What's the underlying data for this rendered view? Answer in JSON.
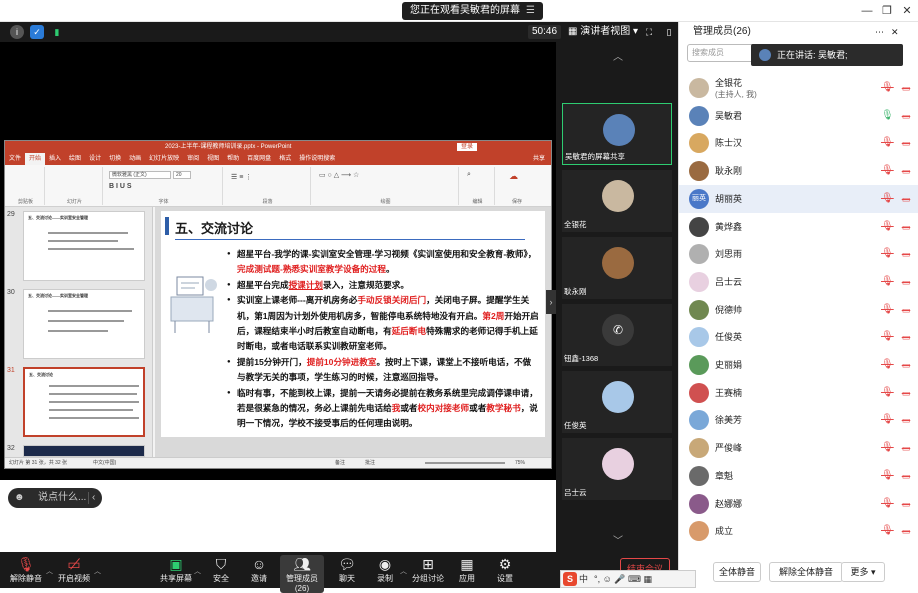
{
  "window": {
    "viewing_banner": "您正在观看吴敏君的屏幕",
    "minimize": "—",
    "restore": "❐",
    "close": "✕"
  },
  "topbar": {
    "timer": "50:46",
    "view_mode": "演讲者视图"
  },
  "ppt": {
    "title": "2023-上半年-课程教师培训录.pptx - PowerPoint",
    "login": "登录",
    "share": "共享",
    "tabs": [
      "文件",
      "开始",
      "插入",
      "绘图",
      "设计",
      "切换",
      "动画",
      "幻灯片放映",
      "审阅",
      "视图",
      "帮助",
      "百度网盘",
      "格式",
      "操作说明搜索"
    ],
    "active_tab": "开始",
    "ribbon_groups": [
      "剪贴板",
      "幻灯片",
      "字体",
      "段落",
      "绘图",
      "编辑",
      "保存"
    ],
    "font_name": "微软雅黑 (正文)",
    "font_size": "20",
    "thumb_nums": [
      "29",
      "30",
      "31",
      "32"
    ],
    "thumb_titles": [
      "五、交流讨论——实训室安全管理",
      "五、交流讨论——实训室安全管理",
      "五、交流讨论",
      ""
    ],
    "status_left": "幻灯片 第 31 张，共 32 张",
    "status_lang": "中文(中国)",
    "status_notes": "备注",
    "status_comments": "批注",
    "status_zoom": "75%"
  },
  "slide": {
    "title": "五、交流讨论",
    "b1_a": "超星平台-我学的课-实训室安全管理-学习视频《实训室使用和安全教育-教师》，",
    "b1_b": "完成测试题-熟悉实训室教学设备的过程",
    "b1_c": "。",
    "b2_a": "超星平台完成",
    "b2_b": "授课计划",
    "b2_c": "录入，注意规范要求。",
    "b3_a": "实训室上课老师---离开机房务必",
    "b3_b": "手动反锁关闭后门",
    "b3_c": "，关闭电子屏。提醒学生关机，第1周因为计划外使用机房多，智能停电系统特地没有开启。",
    "b3_d": "第2周",
    "b3_e": "开始开启后，课程结束半小时后教室自动断电，有",
    "b3_f": "延后断电",
    "b3_g": "特殊需求的老师记得手机上延时断电，或者电话联系实训教研室老师。",
    "b4_a": "提前15分钟开门，",
    "b4_b": "提前10分钟进教室",
    "b4_c": "。按时上下课，课堂上不接听电话，不做与教学无关的事项，学生练习的时候，注意巡回指导。",
    "b5_a": "临时有事，不能到校上课，提前一天请务必提前在教务系统里完成调停课申请，若是很紧急的情况，务必上课前先电话给",
    "b5_b": "我",
    "b5_c": "或者",
    "b5_d": "校内对接老师",
    "b5_e": "或者",
    "b5_f": "教学秘书",
    "b5_g": "，说明一下情况，学校不接受事后的任何理由说明。"
  },
  "chat": {
    "placeholder": "说点什么...",
    "collapse": "‹"
  },
  "strip": {
    "tiles": [
      {
        "name": "吴敏君的屏幕共享",
        "color": "#5a82b8"
      },
      {
        "name": "全银花",
        "color": "#c9b8a0"
      },
      {
        "name": "耿永刚",
        "color": "#9a6a40"
      },
      {
        "name": "钮鑫-1368",
        "color": "#3a3a3a"
      },
      {
        "name": "任俊英",
        "color": "#a8c8e8"
      },
      {
        "name": "吕士云",
        "color": "#e8d0e0"
      }
    ]
  },
  "panel": {
    "title": "管理成员(26)",
    "search_placeholder": "搜索成员",
    "speaking": "正在讲话: 吴敏君;",
    "members": [
      {
        "name": "全银花",
        "sub": "(主持人, 我)",
        "color": "#c9b8a0",
        "mic": "off"
      },
      {
        "name": "吴敏君",
        "sub": "",
        "color": "#5a82b8",
        "mic": "on"
      },
      {
        "name": "陈士汉",
        "sub": "",
        "color": "#d8a860",
        "mic": "off"
      },
      {
        "name": "耿永刚",
        "sub": "",
        "color": "#9a6a40",
        "mic": "off"
      },
      {
        "name": "胡丽英",
        "sub": "",
        "color": "#4a78c8",
        "mic": "off",
        "initials": "丽英"
      },
      {
        "name": "黄烨鑫",
        "sub": "",
        "color": "#444444",
        "mic": "off"
      },
      {
        "name": "刘思雨",
        "sub": "",
        "color": "#b0b0b0",
        "mic": "off"
      },
      {
        "name": "吕士云",
        "sub": "",
        "color": "#e8d0e0",
        "mic": "off"
      },
      {
        "name": "倪德帅",
        "sub": "",
        "color": "#708850",
        "mic": "off"
      },
      {
        "name": "任俊英",
        "sub": "",
        "color": "#a8c8e8",
        "mic": "off"
      },
      {
        "name": "史丽娟",
        "sub": "",
        "color": "#5a9a5a",
        "mic": "off"
      },
      {
        "name": "王赛楠",
        "sub": "",
        "color": "#d05050",
        "mic": "off"
      },
      {
        "name": "徐美芳",
        "sub": "",
        "color": "#7aa8d8",
        "mic": "off"
      },
      {
        "name": "严俊峰",
        "sub": "",
        "color": "#c8a878",
        "mic": "off"
      },
      {
        "name": "章魁",
        "sub": "",
        "color": "#6a6a6a",
        "mic": "off"
      },
      {
        "name": "赵娜娜",
        "sub": "",
        "color": "#8a5a8a",
        "mic": "off"
      },
      {
        "name": "成立",
        "sub": "",
        "color": "#d89a6a",
        "mic": "off"
      }
    ],
    "btn_mute_all": "全体静音",
    "btn_unmute_all": "解除全体静音",
    "btn_more": "更多 ▾"
  },
  "toolbar": {
    "unmute": "解除静音",
    "start_video": "开启视频",
    "share_screen": "共享屏幕",
    "security": "安全",
    "invite": "邀请",
    "manage_members": "管理成员(26)",
    "chat": "聊天",
    "record": "录制",
    "breakout": "分组讨论",
    "apps": "应用",
    "settings": "设置",
    "end_meeting": "结束会议"
  },
  "ime": {
    "brand": "S",
    "label": "中",
    "extras": "°, ☺ 🎤 ⌨ ▦"
  }
}
